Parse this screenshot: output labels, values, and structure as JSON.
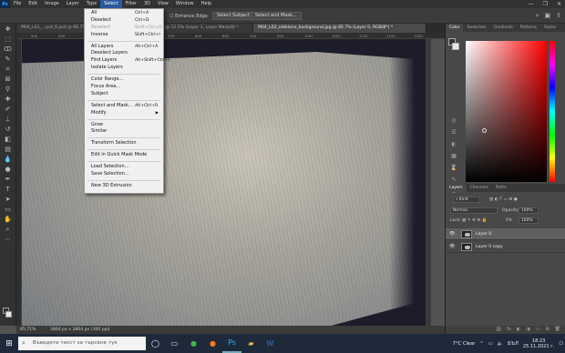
{
  "app": {
    "logo": "Ps"
  },
  "menubar": {
    "items": [
      "File",
      "Edit",
      "Image",
      "Layer",
      "Type",
      "Select",
      "Filter",
      "3D",
      "View",
      "Window",
      "Help"
    ],
    "active": "Select",
    "window_controls": [
      "—",
      "❐",
      "✕"
    ]
  },
  "options_bar": {
    "enhance_edge": "Enhance Edge",
    "select_subject": "Select Subject",
    "select_and_mask": "Select and Mask...",
    "right_icons": [
      "⌕",
      "▣",
      "⇪"
    ]
  },
  "tabs": [
    {
      "label": "M04_L01_...put_6.psd @ 66.7%",
      "active": false
    },
    {
      "label": "...idlane.jpg @ 12.5% (Layer 1, Layer Mask/8) *",
      "active": false
    },
    {
      "label": "M04_L02_oldelane_background.jpg @ 85.7% (Layer 0, RGB/8*) *",
      "active": true
    }
  ],
  "ruler_ticks": [
    "500",
    "550",
    "600",
    "650",
    "700",
    "750",
    "800",
    "850",
    "900",
    "950",
    "1000",
    "1050",
    "1100",
    "1150",
    "1200"
  ],
  "select_menu": [
    {
      "label": "All",
      "shortcut": "Ctrl+A",
      "disabled": false
    },
    {
      "label": "Deselect",
      "shortcut": "Ctrl+D",
      "disabled": false
    },
    {
      "label": "Reselect",
      "shortcut": "Shift+Ctrl+D",
      "disabled": true
    },
    {
      "label": "Inverse",
      "shortcut": "Shift+Ctrl+I",
      "disabled": false
    },
    {
      "sep": true
    },
    {
      "label": "All Layers",
      "shortcut": "Alt+Ctrl+A",
      "disabled": false
    },
    {
      "label": "Deselect Layers",
      "shortcut": "",
      "disabled": false
    },
    {
      "label": "Find Layers",
      "shortcut": "Alt+Shift+Ctrl+F",
      "disabled": false
    },
    {
      "label": "Isolate Layers",
      "shortcut": "",
      "disabled": false
    },
    {
      "sep": true
    },
    {
      "label": "Color Range...",
      "shortcut": "",
      "disabled": false
    },
    {
      "label": "Focus Area...",
      "shortcut": "",
      "disabled": false
    },
    {
      "label": "Subject",
      "shortcut": "",
      "disabled": false
    },
    {
      "sep": true
    },
    {
      "label": "Select and Mask...",
      "shortcut": "Alt+Ctrl+R",
      "disabled": false
    },
    {
      "label": "Modify",
      "shortcut": "",
      "disabled": false,
      "submenu": true
    },
    {
      "sep": true
    },
    {
      "label": "Grow",
      "shortcut": "",
      "disabled": false
    },
    {
      "label": "Similar",
      "shortcut": "",
      "disabled": false
    },
    {
      "sep": true
    },
    {
      "label": "Transform Selection",
      "shortcut": "",
      "disabled": false
    },
    {
      "sep": true
    },
    {
      "label": "Edit in Quick Mask Mode",
      "shortcut": "",
      "disabled": false
    },
    {
      "sep": true
    },
    {
      "label": "Load Selection...",
      "shortcut": "",
      "disabled": false
    },
    {
      "label": "Save Selection...",
      "shortcut": "",
      "disabled": false
    },
    {
      "sep": true
    },
    {
      "label": "New 3D Extrusion",
      "shortcut": "",
      "disabled": false
    }
  ],
  "color_panel": {
    "tabs": [
      "Color",
      "Swatches",
      "Gradients",
      "Patterns",
      "Styles"
    ],
    "active": "Color"
  },
  "layers_panel": {
    "tabs": [
      "Layers",
      "Channels",
      "Paths"
    ],
    "active": "Layers",
    "kind_label": "Kind",
    "blend_mode": "Normal",
    "opacity_label": "Opacity:",
    "opacity_value": "100%",
    "lock_label": "Lock:",
    "fill_label": "Fill:",
    "fill_value": "100%",
    "layers": [
      {
        "name": "Layer 0",
        "selected": true
      },
      {
        "name": "Layer 0 copy",
        "selected": false
      }
    ],
    "bottom_icons": [
      "⛓",
      "fx",
      "◐",
      "◑",
      "▭",
      "⊞",
      "🗑"
    ]
  },
  "status_bar": {
    "zoom": "85,71%",
    "doc_size": "3864 px x 3864 px (300 ppi)"
  },
  "taskbar": {
    "search_placeholder": "Въведете текст за търсене тук",
    "weather": "7°C  Clear",
    "language": "БЪЛ",
    "time": "18:23",
    "date": "25.11.2021 г."
  }
}
